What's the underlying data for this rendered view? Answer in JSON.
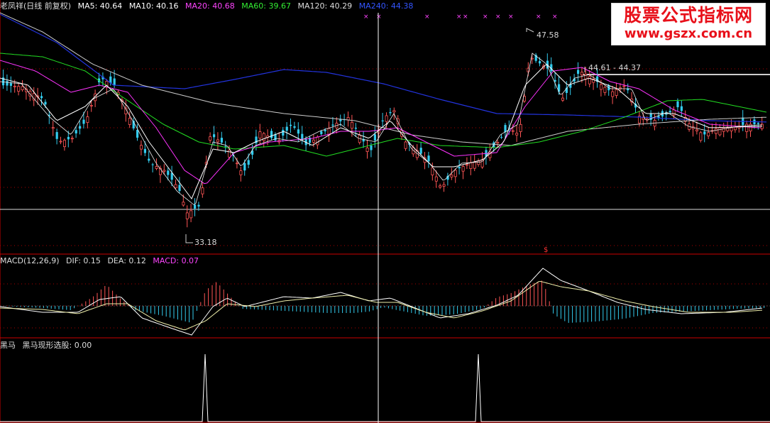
{
  "header": {
    "stock_name": "老凤祥(日线 前复权)",
    "ma": [
      {
        "label": "MA5: 40.64",
        "color": "#ffffff"
      },
      {
        "label": "MA10: 40.16",
        "color": "#ffffff"
      },
      {
        "label": "MA20: 40.68",
        "color": "#ff44ff"
      },
      {
        "label": "MA60: 39.67",
        "color": "#33ee33"
      },
      {
        "label": "MA120: 40.29",
        "color": "#dddddd"
      },
      {
        "label": "MA240: 44.38",
        "color": "#3355ff"
      }
    ]
  },
  "watermark": {
    "line1": "股票公式指标网",
    "line2": "www.gszx.com.cn"
  },
  "annotations": {
    "high": "47.58",
    "low": "33.18",
    "range": "44.61 - 44.37",
    "s_mark": "$"
  },
  "macd_header": [
    {
      "label": "MACD(12,26,9)",
      "color": "#dddddd"
    },
    {
      "label": "DIF: 0.15",
      "color": "#dddddd"
    },
    {
      "label": "DEA: 0.12",
      "color": "#dddddd"
    },
    {
      "label": "MACD: 0.07",
      "color": "#ff44ff"
    }
  ],
  "heima_header": [
    {
      "label": "黑马",
      "color": "#dddddd"
    },
    {
      "label": "黑马现形选股: 0.00",
      "color": "#dddddd"
    }
  ],
  "colors": {
    "up": "#ff5555",
    "down": "#33ccee",
    "grid": "#aa0000",
    "crosshair": "#ffffff",
    "signal": "#ff44ff"
  },
  "chart_data": [
    {
      "type": "candlestick",
      "y_range": [
        33.18,
        47.58
      ],
      "series": [
        {
          "name": "MA5",
          "value_last": 40.64
        },
        {
          "name": "MA10",
          "value_last": 40.16
        },
        {
          "name": "MA20",
          "value_last": 40.68
        },
        {
          "name": "MA60",
          "value_last": 39.67
        },
        {
          "name": "MA120",
          "value_last": 40.29
        },
        {
          "name": "MA240",
          "value_last": 44.38
        }
      ],
      "annotations": [
        {
          "label": "47.58"
        },
        {
          "label": "33.18"
        },
        {
          "label": "44.61 - 44.37"
        }
      ]
    },
    {
      "type": "bar",
      "series": [
        {
          "name": "DIF",
          "value_last": 0.15
        },
        {
          "name": "DEA",
          "value_last": 0.12
        },
        {
          "name": "MACD",
          "value_last": 0.07
        }
      ]
    },
    {
      "type": "line",
      "series": [
        {
          "name": "黑马现形选股",
          "value_last": 0.0
        }
      ]
    }
  ]
}
